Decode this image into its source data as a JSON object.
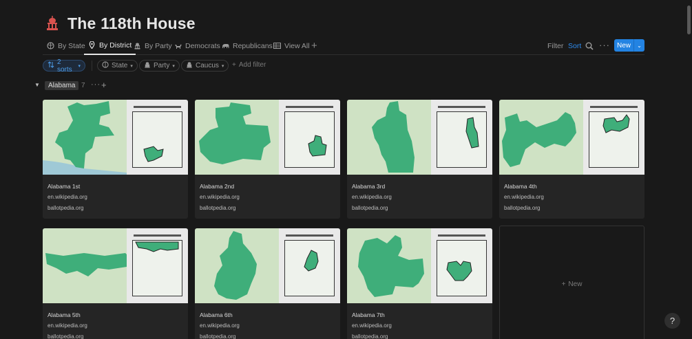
{
  "page": {
    "title": "The 118th House",
    "icon": "capitol-building-icon"
  },
  "tabs": [
    {
      "label": "By State",
      "icon": "brain-icon",
      "active": false
    },
    {
      "label": "By District",
      "icon": "map-pin-icon",
      "active": true
    },
    {
      "label": "By Party",
      "icon": "capitol-building-icon",
      "active": false
    },
    {
      "label": "Democrats",
      "icon": "donkey-icon",
      "active": false
    },
    {
      "label": "Republicans",
      "icon": "elephant-icon",
      "active": false
    },
    {
      "label": "View All",
      "icon": "table-icon",
      "active": false
    }
  ],
  "toolbar": {
    "filter": "Filter",
    "sort": "Sort",
    "new": "New",
    "more": "···"
  },
  "filters": {
    "sorts": "2 sorts",
    "state": "State",
    "party": "Party",
    "caucus": "Caucus",
    "add_filter": "Add filter"
  },
  "group": {
    "label": "Alabama",
    "count": "7"
  },
  "cards": [
    {
      "name": "Alabama 1st",
      "link1": "en.wikipedia.org",
      "link2": "ballotpedia.org"
    },
    {
      "name": "Alabama 2nd",
      "link1": "en.wikipedia.org",
      "link2": "ballotpedia.org"
    },
    {
      "name": "Alabama 3rd",
      "link1": "en.wikipedia.org",
      "link2": "ballotpedia.org"
    },
    {
      "name": "Alabama 4th",
      "link1": "en.wikipedia.org",
      "link2": "ballotpedia.org"
    },
    {
      "name": "Alabama 5th",
      "link1": "en.wikipedia.org",
      "link2": "ballotpedia.org"
    },
    {
      "name": "Alabama 6th",
      "link1": "en.wikipedia.org",
      "link2": "ballotpedia.org"
    },
    {
      "name": "Alabama 7th",
      "link1": "en.wikipedia.org",
      "link2": "ballotpedia.org"
    }
  ],
  "new_card": {
    "label": "New"
  },
  "help": {
    "label": "?"
  },
  "colors": {
    "accent": "#2383e2",
    "district": "#3fae7a",
    "background": "#191919",
    "card": "#252525"
  }
}
